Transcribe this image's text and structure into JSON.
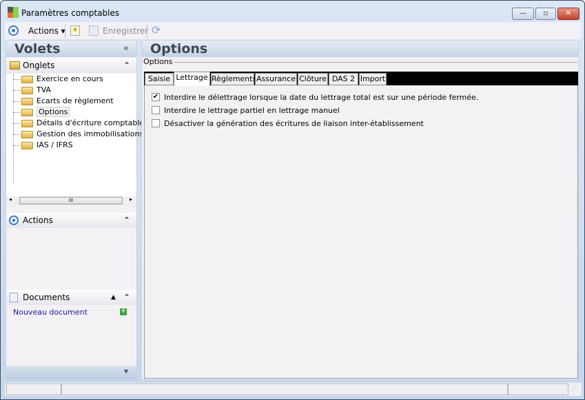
{
  "window": {
    "title": "Paramètres comptables",
    "min": "—",
    "max": "▫",
    "close": "✕"
  },
  "toolbar": {
    "actions_label": "Actions",
    "save_label": "Enregistrer"
  },
  "left": {
    "title": "Volets",
    "collapse": "«",
    "onglets": {
      "label": "Onglets",
      "items": [
        "Exercice en cours",
        "TVA",
        "Ecarts de règlement",
        "Options",
        "Détails d'écriture comptable",
        "Gestion des immobilisations",
        "IAS / IFRS"
      ],
      "selected": "Options"
    },
    "actions": {
      "label": "Actions"
    },
    "documents": {
      "label": "Documents",
      "new_doc": "Nouveau document"
    }
  },
  "main": {
    "title": "Options",
    "group_label": "Options",
    "tabs": [
      "Saisie",
      "Lettrage",
      "Règlements",
      "Assurance",
      "Clôture",
      "DAS 2",
      "Import"
    ],
    "active_tab": "Lettrage",
    "options": [
      {
        "label": "Interdire le délettrage lorsque la date du lettrage total est sur une période fermée.",
        "checked": true
      },
      {
        "label": "Interdire le lettrage partiel en lettrage manuel",
        "checked": false
      },
      {
        "label": "Désactiver la génération des écritures de liaison inter-établissement",
        "checked": false
      }
    ]
  },
  "scroll": {
    "thumb": "III"
  }
}
